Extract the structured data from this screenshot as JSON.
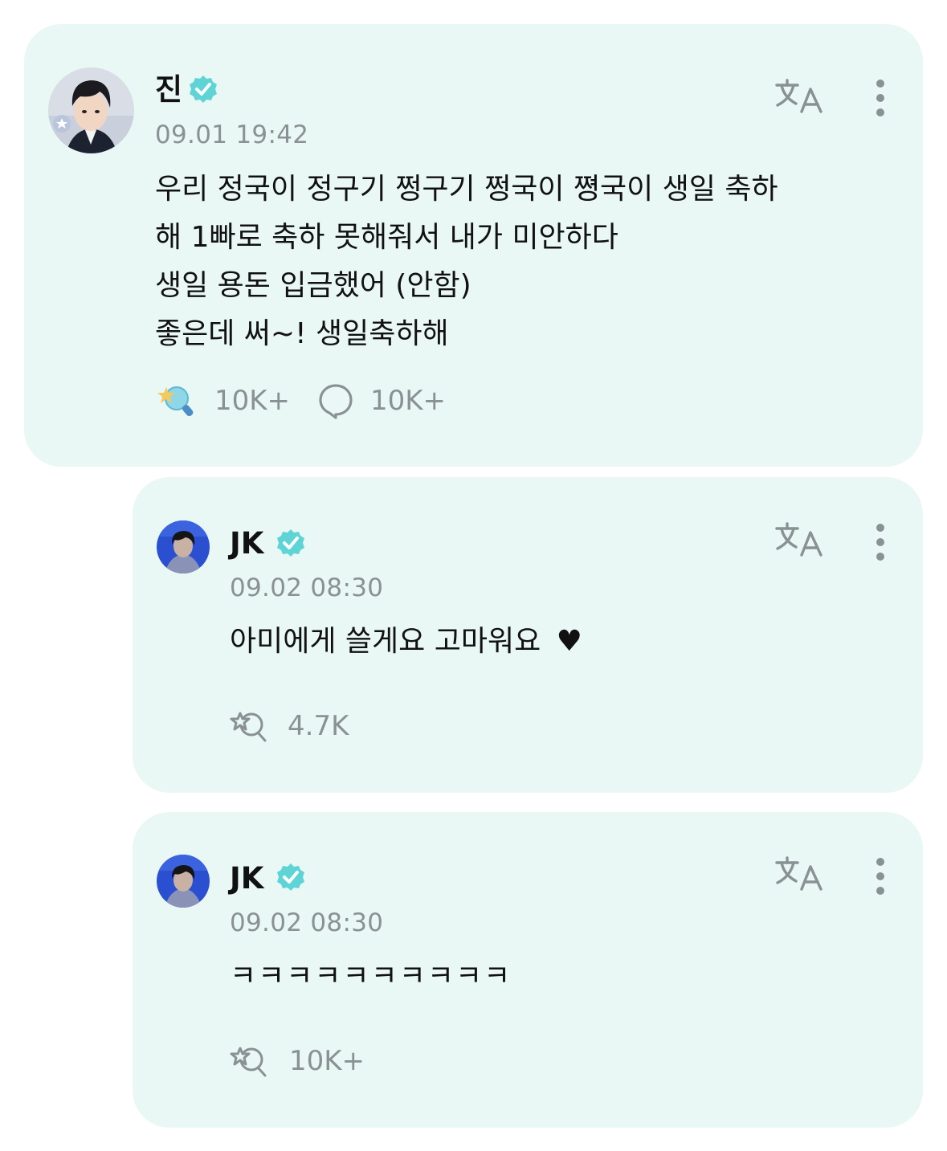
{
  "colors": {
    "card_bg": "#e9f8f5",
    "verified_badge": "#5fd4d6",
    "meta_gray": "#8a9194",
    "text": "#111111"
  },
  "posts": [
    {
      "author": "진",
      "verified": true,
      "timestamp": "09.01 19:42",
      "lines": [
        "우리 정국이 정구기 쩡구기 쩡국이 쪙국이 생일 축하",
        "해 1빠로 축하 못해줘서 내가 미안하다",
        "생일 용돈 입금했어 (안함)",
        "좋은데 써~! 생일축하해"
      ],
      "likes": "10K+",
      "comments": "10K+",
      "like_icon": "colored-star-lightstick-icon",
      "comment_icon": "speech-bubble-icon"
    },
    {
      "author": "JK",
      "verified": true,
      "timestamp": "09.02 08:30",
      "text": "아미에게 쓸게요 고마워요",
      "emoji": "♥",
      "likes": "4.7K",
      "like_icon": "star-lightstick-outline-icon"
    },
    {
      "author": "JK",
      "verified": true,
      "timestamp": "09.02 08:30",
      "text": "ㅋㅋㅋㅋㅋㅋㅋㅋㅋㅋ",
      "likes": "10K+",
      "like_icon": "star-lightstick-outline-icon"
    }
  ]
}
